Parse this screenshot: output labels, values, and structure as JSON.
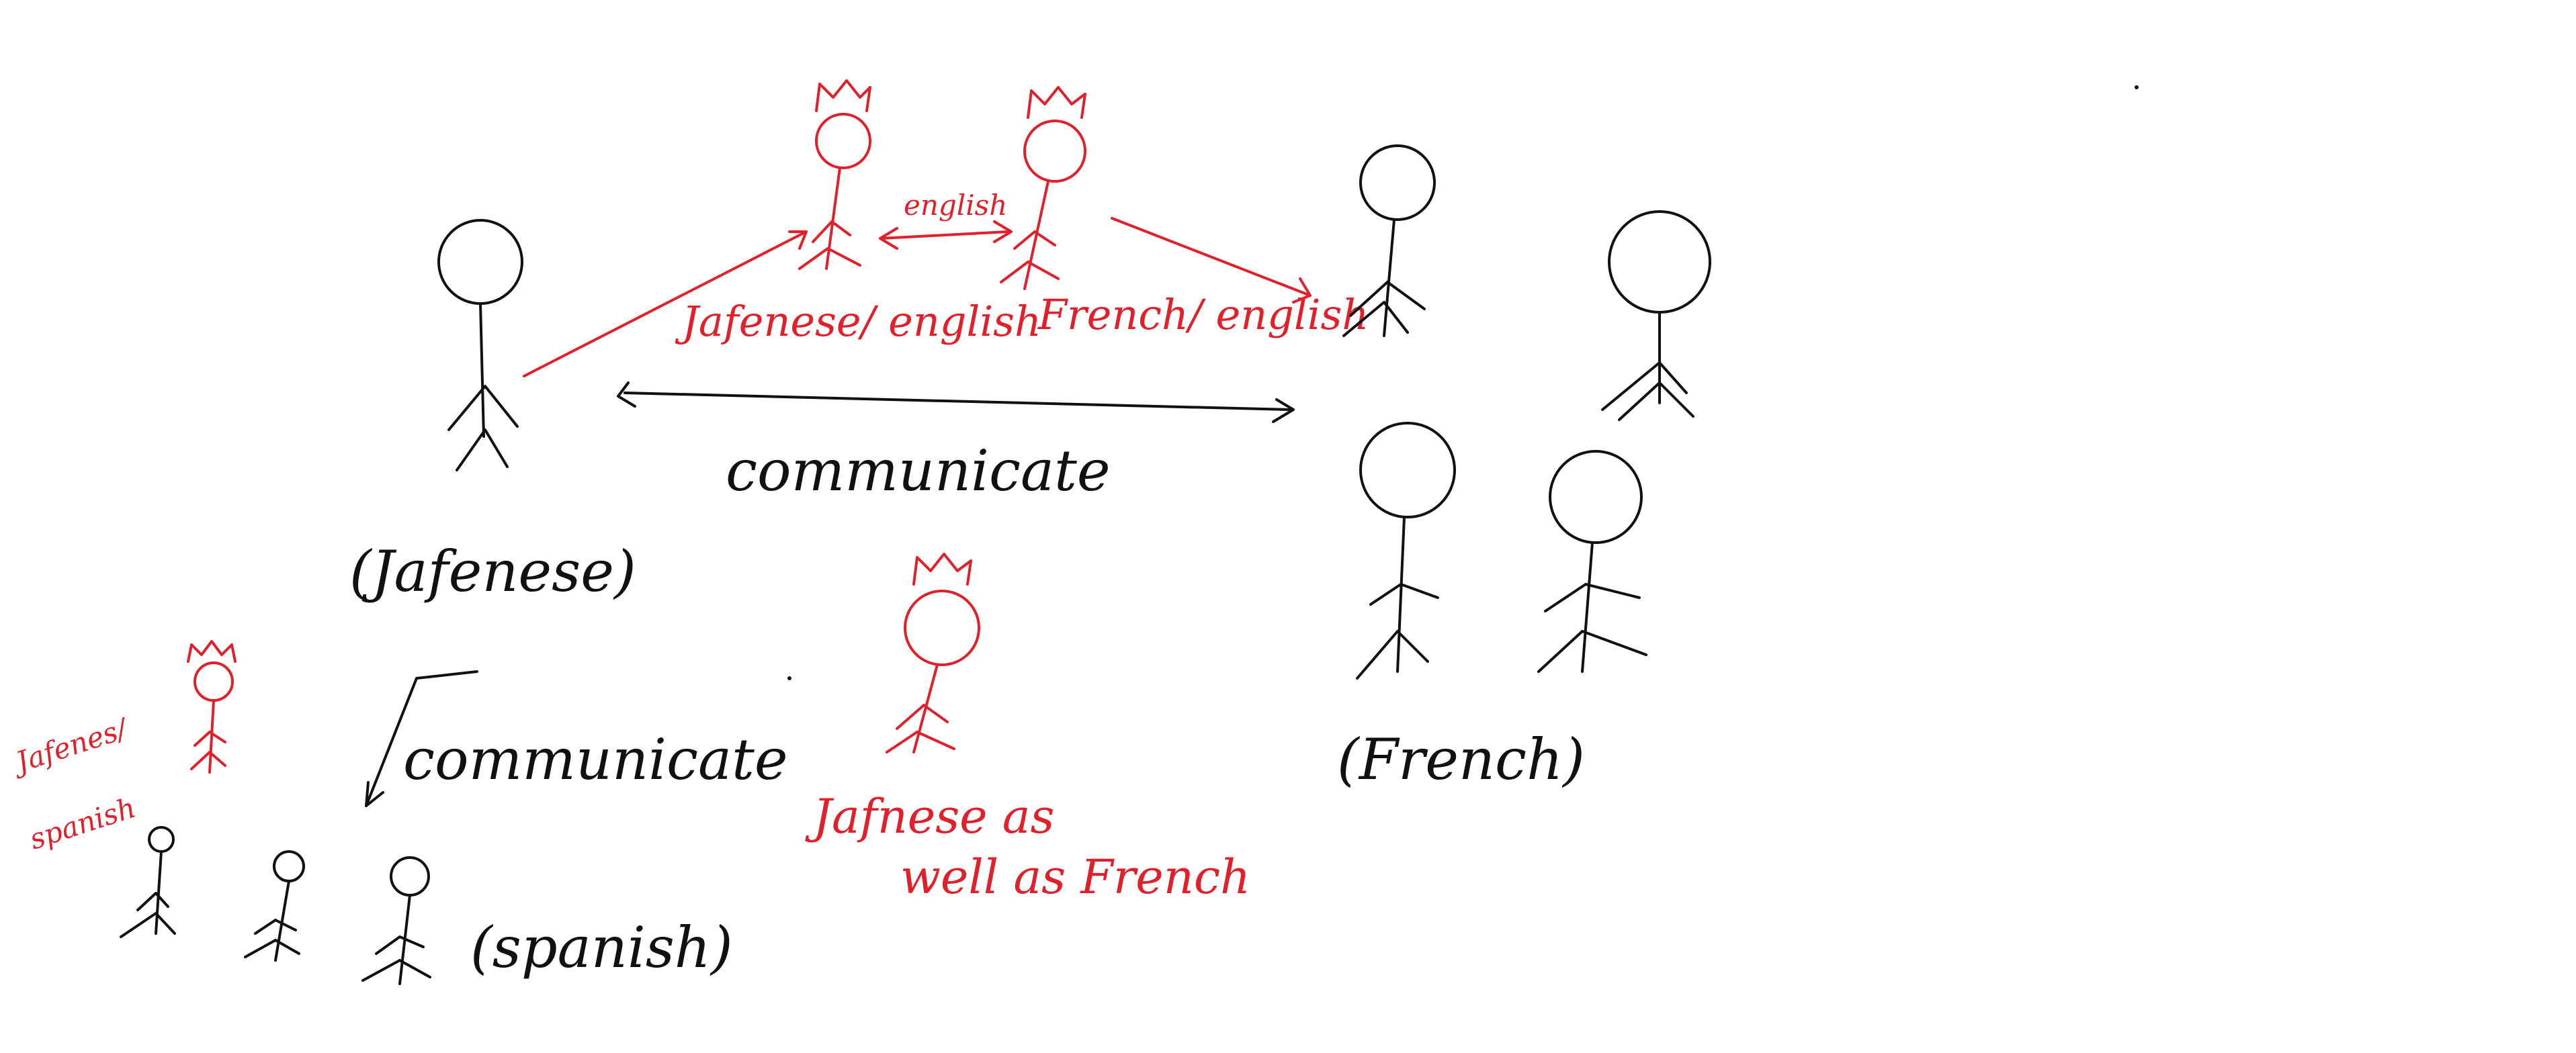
{
  "diagram": {
    "groups": [
      {
        "id": "japanese",
        "label": "(Jafenese)"
      },
      {
        "id": "french",
        "label": "(French)"
      },
      {
        "id": "spanish",
        "label": "(spanish)"
      }
    ],
    "translators": [
      {
        "id": "jp-en",
        "label": "Jafenese/ english"
      },
      {
        "id": "fr-en",
        "label": "French/ english"
      },
      {
        "id": "jp-fr",
        "line1": "Jafnese as",
        "line2": "well as French"
      },
      {
        "id": "jp-es",
        "line1": "Jafenes/",
        "line2": "spanish"
      }
    ],
    "links": [
      {
        "id": "translators-link",
        "label": "english"
      },
      {
        "id": "jp-fr-link",
        "label": "communicate"
      },
      {
        "id": "jp-es-link",
        "label": "communicate"
      }
    ]
  },
  "colors": {
    "ink": "#111111",
    "annotation": "#e0202a"
  }
}
